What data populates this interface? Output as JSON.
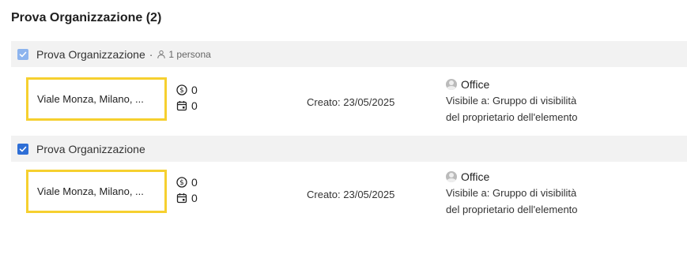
{
  "title": "Prova Organizzazione (2)",
  "groups": [
    {
      "name": "Prova Organizzazione",
      "separator": "·",
      "people_count": "1 persona",
      "item": {
        "address": "Viale Monza, Milano, ...",
        "money_count": "0",
        "calendar_count": "0",
        "created": "Creato: 23/05/2025",
        "owner": "Office",
        "visibility_line1": "Visibile a: Gruppo di visibilità",
        "visibility_line2": "del proprietario dell'elemento"
      }
    },
    {
      "name": "Prova Organizzazione",
      "item": {
        "address": "Viale Monza, Milano, ...",
        "money_count": "0",
        "calendar_count": "0",
        "created": "Creato: 23/05/2025",
        "owner": "Office",
        "visibility_line1": "Visibile a: Gruppo di visibilità",
        "visibility_line2": "del proprietario dell'elemento"
      }
    }
  ],
  "colors": {
    "highlight_border": "#f6d02f",
    "checkbox_light": "#8db4ee",
    "checkbox_dark": "#2f6fd6",
    "header_bg": "#f2f2f2"
  },
  "icons": [
    "check-icon",
    "person-icon",
    "money-icon",
    "calendar-icon",
    "avatar-icon"
  ]
}
